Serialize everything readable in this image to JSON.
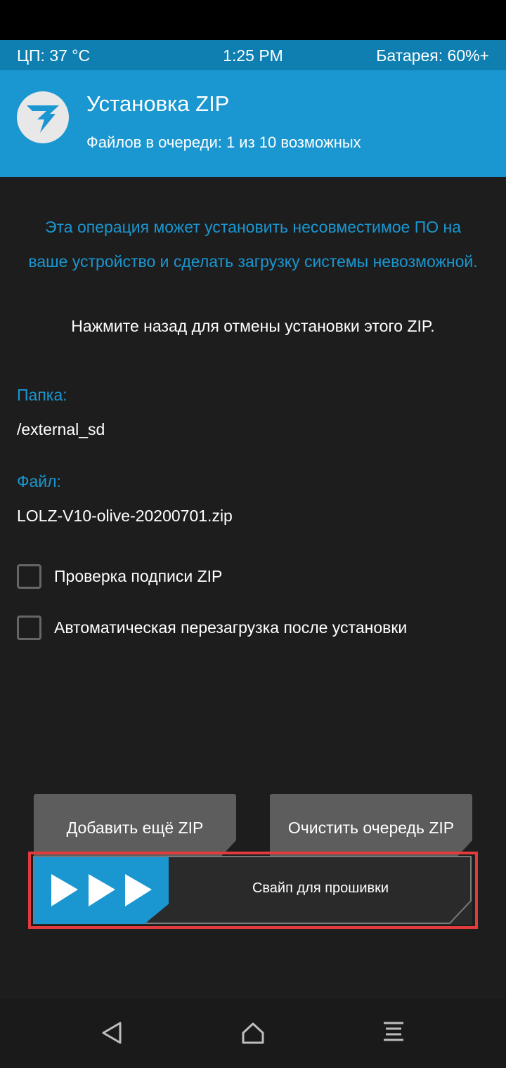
{
  "statusbar": {
    "cpu": "ЦП: 37 °C",
    "time": "1:25 PM",
    "battery": "Батарея: 60%+"
  },
  "header": {
    "icon": "twrp-logo-icon",
    "title": "Установка ZIP",
    "subtitle": "Файлов в очереди: 1 из 10 возможных"
  },
  "warning": {
    "line1": "Эта операция может установить несовместимое ПО на",
    "line2": "ваше устройство и сделать загрузку системы невозможной."
  },
  "back_note": "Нажмите назад для отмены установки этого ZIP.",
  "folder": {
    "label": "Папка:",
    "value": "/external_sd"
  },
  "file": {
    "label": "Файл:",
    "value": "LOLZ-V10-olive-20200701.zip"
  },
  "options": [
    {
      "label": "Проверка подписи ZIP",
      "checked": false
    },
    {
      "label": "Автоматическая перезагрузка после установки",
      "checked": false
    }
  ],
  "buttons": {
    "add_zip": "Добавить ещё ZIP",
    "clear_queue": "Очистить очередь ZIP"
  },
  "swipe": {
    "label": "Свайп для прошивки",
    "icon": "triple-arrow-icon"
  },
  "navbar": {
    "back_icon": "back-triangle-icon",
    "home_icon": "home-icon",
    "menu_icon": "menu-icon"
  },
  "colors": {
    "accent": "#1a96d0",
    "statusbar": "#0e7fb0",
    "background": "#1d1d1d",
    "button": "#5d5d5d",
    "highlight": "#e23b3b"
  }
}
